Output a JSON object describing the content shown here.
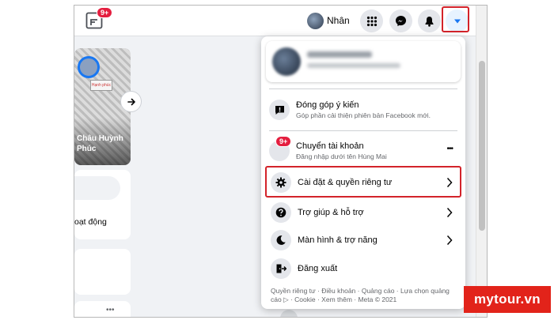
{
  "header": {
    "notifications_badge": "9+",
    "profile_name": "Nhân"
  },
  "feed": {
    "story_caption": "Châu Huỳnh Phúc",
    "story_sign_text": "Hạnh phúc",
    "activity_text": "oạt động",
    "more_dots": "•••"
  },
  "menu": {
    "feedback": {
      "title": "Đóng góp ý kiến",
      "subtitle": "Góp phần cải thiện phiên bản Facebook mới."
    },
    "switch_account": {
      "badge": "9+",
      "title": "Chuyển tài khoản",
      "subtitle": "Đăng nhập dưới tên Hùng Mai",
      "more": "•••"
    },
    "settings": {
      "title": "Cài đặt & quyền riêng tư"
    },
    "help": {
      "title": "Trợ giúp & hỗ trợ"
    },
    "display": {
      "title": "Màn hình & trợ năng"
    },
    "logout": {
      "title": "Đăng xuất"
    },
    "footer": "Quyền riêng tư · Điều khoản · Quảng cáo · Lựa chọn quảng cáo ▷ · Cookie · Xem thêm · Meta © 2021"
  },
  "watermark": "mytour.vn",
  "colors": {
    "highlight": "#d3232a",
    "badge": "#e41e3f",
    "fb_blue": "#1877f2"
  },
  "icons": {
    "logo": "facebook-logo-icon",
    "apps": "grid-icon",
    "messenger": "messenger-icon",
    "bell": "bell-icon",
    "account": "caret-down-icon",
    "feedback": "feedback-icon",
    "settings": "gear-icon",
    "help": "question-icon",
    "display": "moon-icon",
    "logout": "logout-icon"
  }
}
